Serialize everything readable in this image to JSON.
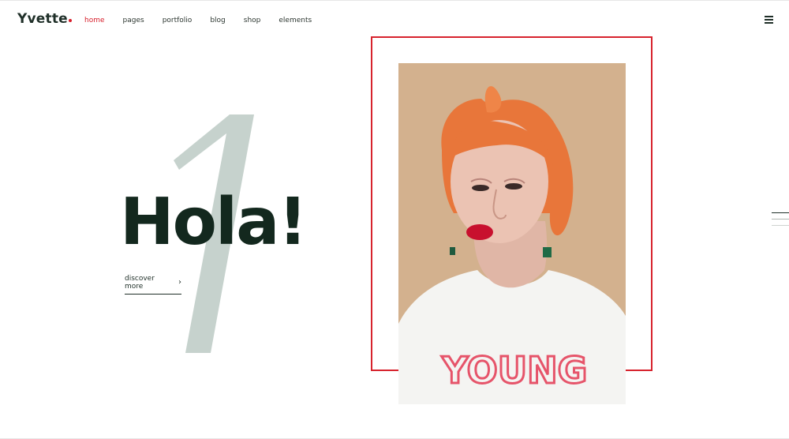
{
  "brand": {
    "name": "Yvette",
    "dot_color": "#d71f2b"
  },
  "nav": {
    "items": [
      {
        "label": "home",
        "active": true
      },
      {
        "label": "pages",
        "active": false
      },
      {
        "label": "portfolio",
        "active": false
      },
      {
        "label": "blog",
        "active": false
      },
      {
        "label": "shop",
        "active": false
      },
      {
        "label": "elements",
        "active": false
      }
    ]
  },
  "header": {
    "menu_icon": "hamburger-menu-icon"
  },
  "hero": {
    "slide_number": "1",
    "title": "Hola!",
    "cta_label": "discover more",
    "cta_icon": "chevron-right-icon",
    "shirt_text": "YOUNG"
  },
  "colors": {
    "accent": "#d71f2b",
    "title": "#13281e",
    "numeral": "#c6d2cd",
    "photo_bg": "#d2b08c"
  },
  "slider": {
    "indicator_icon": "slide-lines-icon"
  }
}
